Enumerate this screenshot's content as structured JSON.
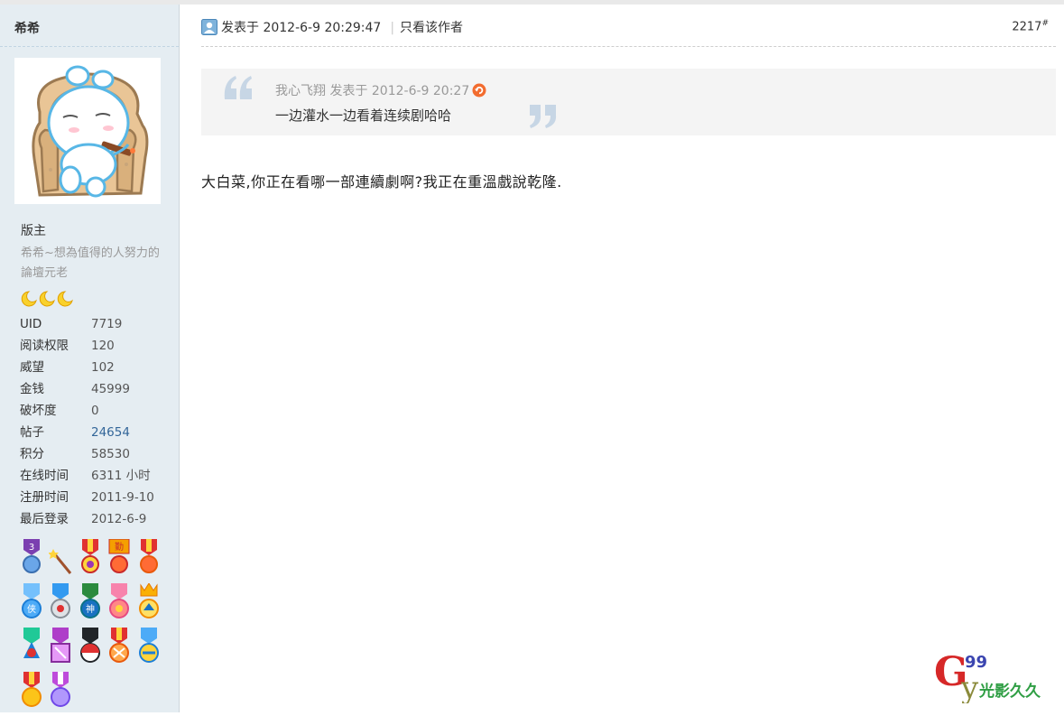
{
  "author": {
    "name": "希希",
    "rank": "版主",
    "signature": "希希~想為值得的人努力的論壇元老",
    "stats": [
      {
        "label": "UID",
        "value": "7719",
        "link": false
      },
      {
        "label": "阅读权限",
        "value": "120",
        "link": false
      },
      {
        "label": "威望",
        "value": "102",
        "link": false
      },
      {
        "label": "金钱",
        "value": "45999",
        "link": false
      },
      {
        "label": "破坏度",
        "value": "0",
        "link": false
      },
      {
        "label": "帖子",
        "value": "24654",
        "link": true
      },
      {
        "label": "积分",
        "value": "58530",
        "link": false
      },
      {
        "label": "在线时间",
        "value": "6311 小时",
        "link": false
      },
      {
        "label": "注册时间",
        "value": "2011-9-10",
        "link": false
      },
      {
        "label": "最后登录",
        "value": "2012-6-9",
        "link": false
      }
    ],
    "star_icons": [
      "moon-icon",
      "moon-icon",
      "moon-icon"
    ],
    "medal_icons": [
      "medal-icon"
    ]
  },
  "post": {
    "meta": "发表于 2012-6-9 20:29:47",
    "author_only_label": "只看该作者",
    "floor": "2217",
    "floor_suffix": "#",
    "quote": {
      "meta": "我心飞翔 发表于 2012-6-9 20:27",
      "text": "一边灌水一边看着连续剧哈哈"
    },
    "body": "大白菜,你正在看哪一部連續劇啊?我正在重溫戲說乾隆."
  },
  "watermark": {
    "big": "G",
    "small": "99",
    "tail": "y",
    "caption": "光影久久"
  },
  "colors": {
    "sidebar_bg": "#e5edf2",
    "link": "#336699",
    "quote_bg": "#f4f4f4",
    "accent_orange": "#f26c2f"
  }
}
